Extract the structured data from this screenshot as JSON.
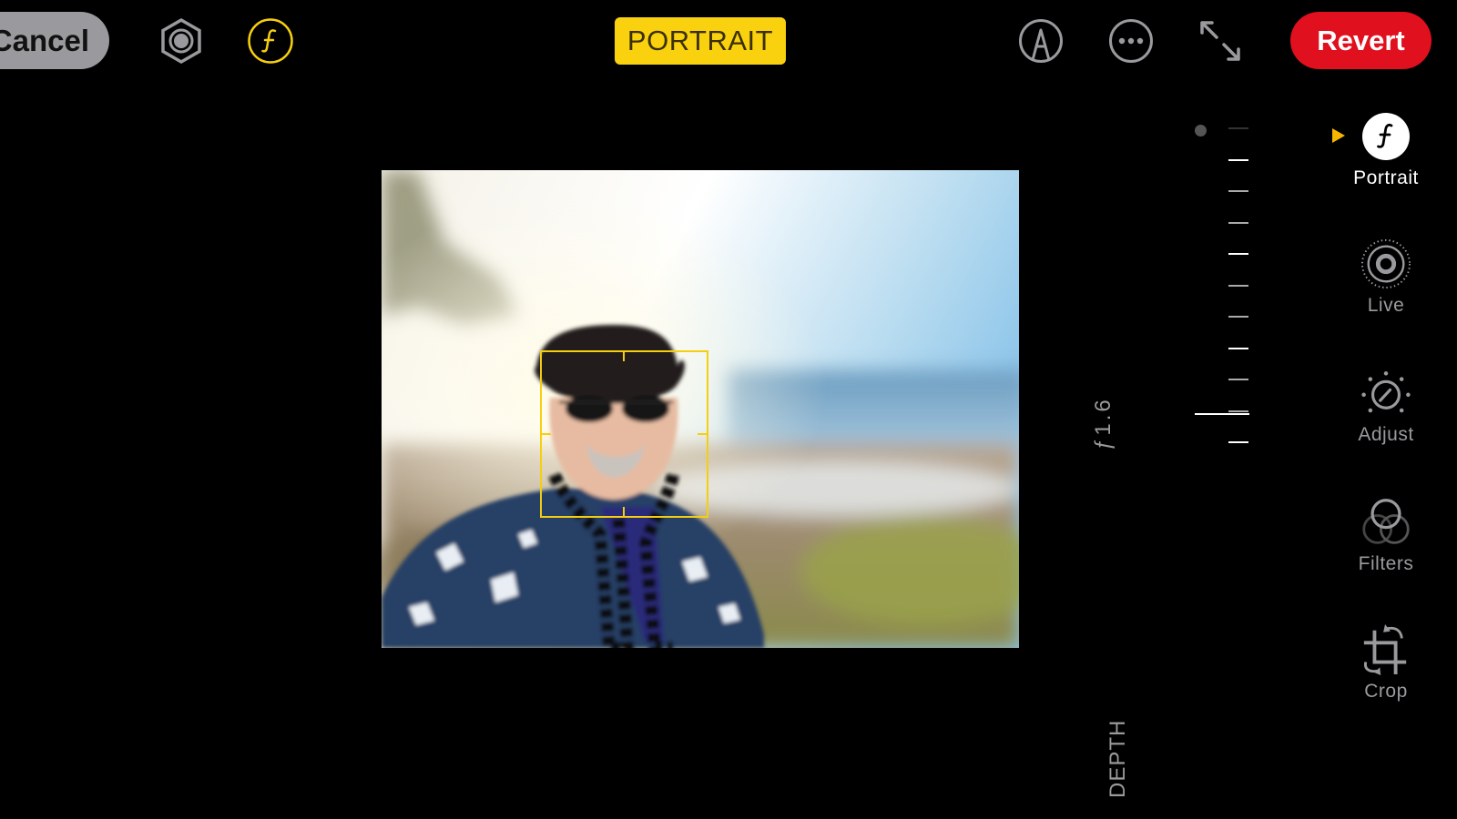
{
  "toolbar": {
    "cancel_label": "Cancel",
    "mode_badge": "PORTRAIT",
    "revert_label": "Revert",
    "icons": [
      "portrait-lighting-icon",
      "aperture-f-icon",
      "markup-icon",
      "more-icon",
      "expand-icon"
    ]
  },
  "depth_control": {
    "aperture_value": "ƒ1.6",
    "label": "DEPTH",
    "selected_fraction": 0.91
  },
  "tools": [
    {
      "label": "Portrait",
      "icon": "portrait-f-icon",
      "active": true
    },
    {
      "label": "Live",
      "icon": "live-icon",
      "active": false
    },
    {
      "label": "Adjust",
      "icon": "adjust-dial-icon",
      "active": false
    },
    {
      "label": "Filters",
      "icon": "filters-icon",
      "active": false
    },
    {
      "label": "Crop",
      "icon": "crop-rotate-icon",
      "active": false
    }
  ],
  "colors": {
    "accent_yellow": "#f9d10f",
    "revert_red": "#e0101e",
    "icon_gray": "#9a9a9e"
  }
}
